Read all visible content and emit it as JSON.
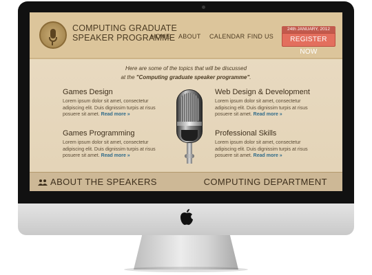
{
  "header": {
    "title_line1": "COMPUTING GRADUATE",
    "title_line2": "SPEAKER PROGRAMME",
    "nav": [
      "HOME",
      "ABOUT",
      "CALENDAR",
      "FIND US"
    ],
    "event_date": "24th JANUARY, 2012",
    "register_label": "REGISTER NOW"
  },
  "intro": {
    "line1": "Here are some of the topics that will be discussed",
    "line2_prefix": "at the ",
    "line2_emphasis": "\"Computing graduate speaker programme\"",
    "line2_suffix": "."
  },
  "topics": [
    {
      "title": "Games Design",
      "body": "Lorem ipsum dolor sit amet, consectetur adipiscing elit. Duis dignissim turpis at risus posuere sit amet.",
      "link": "Read more »"
    },
    {
      "title": "Web Design & Development",
      "body": "Lorem ipsum dolor sit amet, consectetur adipiscing elit. Duis dignissim turpis at risus posuere sit amet.",
      "link": "Read more »"
    },
    {
      "title": "Games Programming",
      "body": "Lorem ipsum dolor sit amet, consectetur adipiscing elit. Duis dignissim turpis at risus posuere sit amet.",
      "link": "Read more »"
    },
    {
      "title": "Professional Skills",
      "body": "Lorem ipsum dolor sit amet, consectetur adipiscing elit. Duis dignissim turpis at risus posuere sit amet.",
      "link": "Read more »"
    }
  ],
  "footer": {
    "about_label": "ABOUT THE SPEAKERS",
    "department_label": "COMPUTING DEPARTMENT"
  },
  "icons": {
    "logo": "microphone-logo-icon",
    "hero": "microphone-illustration",
    "about": "people-icon",
    "device": "apple-logo-icon"
  },
  "colors": {
    "header_bg": "#dcc59b",
    "page_bg": "#e3d3b6",
    "register_button": "#e36f5e",
    "link": "#2f6b8a",
    "text_dark": "#3e2f1c"
  }
}
